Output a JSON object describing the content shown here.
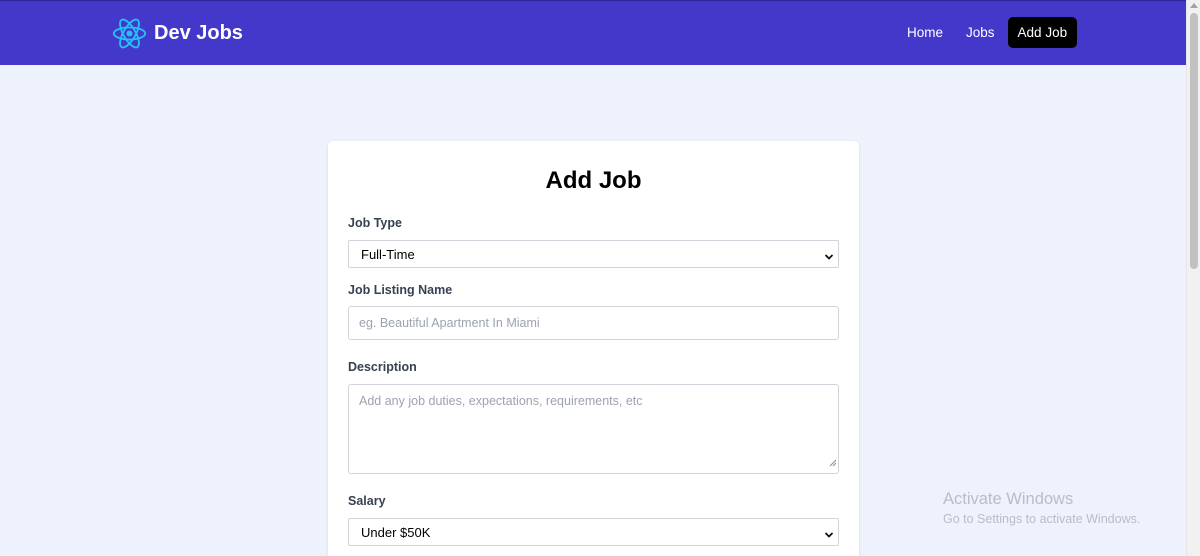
{
  "navbar": {
    "brand": "Dev Jobs",
    "logo_icon": "react-atom-icon",
    "links": [
      {
        "label": "Home",
        "active": false
      },
      {
        "label": "Jobs",
        "active": false
      },
      {
        "label": "Add Job",
        "active": true
      }
    ]
  },
  "form": {
    "title": "Add Job",
    "job_type": {
      "label": "Job Type",
      "value": "Full-Time"
    },
    "listing_name": {
      "label": "Job Listing Name",
      "placeholder": "eg. Beautiful Apartment In Miami",
      "value": ""
    },
    "description": {
      "label": "Description",
      "placeholder": "Add any job duties, expectations, requirements, etc",
      "value": ""
    },
    "salary": {
      "label": "Salary",
      "value": "Under $50K"
    }
  },
  "watermark": {
    "title": "Activate Windows",
    "subtitle": "Go to Settings to activate Windows."
  },
  "colors": {
    "navbar": "#4338ca",
    "page_background": "#eef2fc",
    "active_link": "#000000",
    "logo_accent": "#22c2f5"
  }
}
